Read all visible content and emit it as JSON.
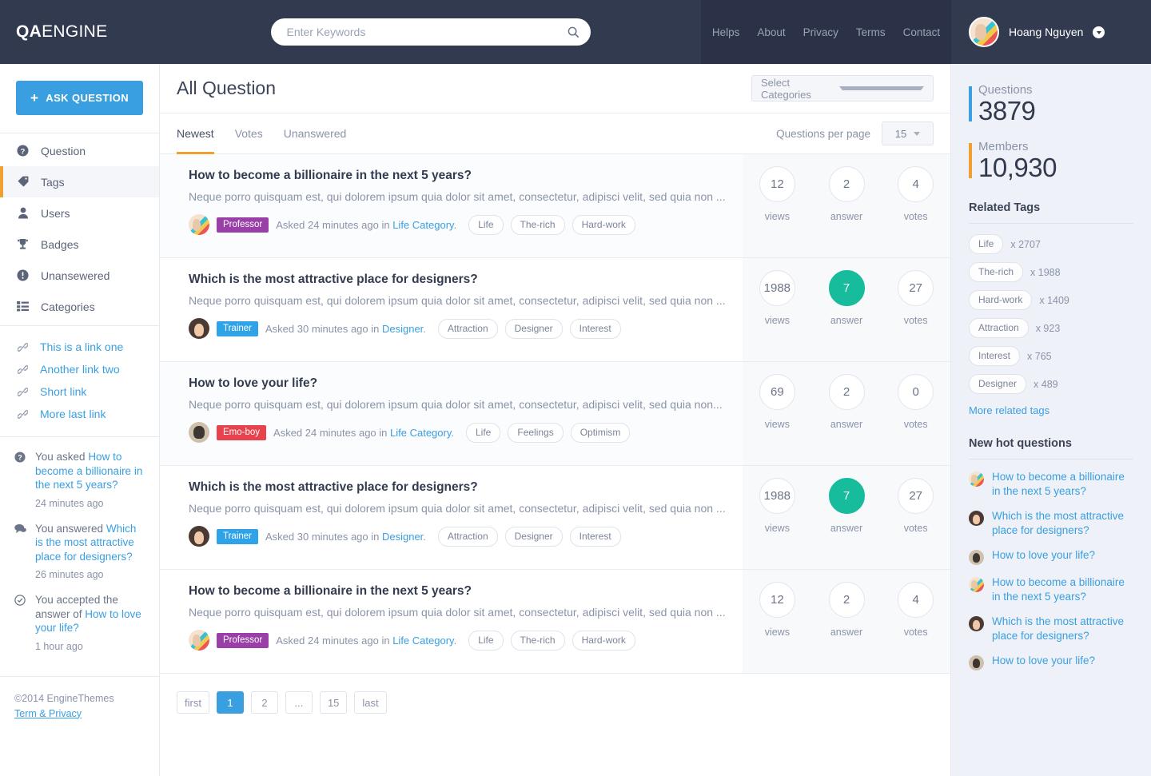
{
  "header": {
    "logo_bold": "QA",
    "logo_rest": "ENGINE",
    "search": {
      "placeholder": "Enter Keywords",
      "value": "",
      "icon": "search-icon"
    },
    "nav": [
      {
        "label": "Helps"
      },
      {
        "label": "About"
      },
      {
        "label": "Privacy"
      },
      {
        "label": "Terms"
      },
      {
        "label": "Contact"
      }
    ],
    "user": {
      "name": "Hoang Nguyen",
      "avatar": "user-avatar",
      "caret": "chevron-down-icon"
    }
  },
  "sidebar": {
    "ask_button": "ASK QUESTION",
    "nav_items": [
      {
        "label": "Question",
        "icon": "question-circle-icon",
        "active": false
      },
      {
        "label": "Tags",
        "icon": "tag-icon",
        "active": true
      },
      {
        "label": "Users",
        "icon": "user-icon",
        "active": false
      },
      {
        "label": "Badges",
        "icon": "trophy-icon",
        "active": false
      },
      {
        "label": "Unansewered",
        "icon": "exclamation-circle-icon",
        "active": false
      },
      {
        "label": "Categories",
        "icon": "list-icon",
        "active": false
      }
    ],
    "links": [
      {
        "label": "This is a link one",
        "icon": "chain-link-icon"
      },
      {
        "label": "Another link two",
        "icon": "chain-link-icon"
      },
      {
        "label": "Short link",
        "icon": "chain-link-icon"
      },
      {
        "label": "More last link",
        "icon": "chain-link-icon"
      }
    ],
    "activity": [
      {
        "icon": "question-circle-icon",
        "prefix": "You asked ",
        "link": "How to become a billionaire in the next 5 years?",
        "time": "24 minutes ago"
      },
      {
        "icon": "comment-icon",
        "prefix": "You answered ",
        "link": "Which is the most attractive place for designers?",
        "time": "26 minutes ago"
      },
      {
        "icon": "check-circle-icon",
        "prefix": "You accepted the answer of ",
        "link": "How to love your life?",
        "time": "1 hour ago"
      }
    ],
    "footer": {
      "copyright": "©2014 EngineThemes",
      "terms_link": "Term & Privacy"
    }
  },
  "main": {
    "page_title": "All Question",
    "category_select": {
      "value": "Select Categories",
      "caret": "chevron-down-icon"
    },
    "tabs": [
      {
        "label": "Newest",
        "active": true
      },
      {
        "label": "Votes",
        "active": false
      },
      {
        "label": "Unanswered",
        "active": false
      }
    ],
    "per_page": {
      "label": "Questions per page",
      "value": "15",
      "caret": "chevron-down-icon"
    },
    "stat_labels": {
      "views": "views",
      "answer": "answer",
      "votes": "votes"
    },
    "questions": [
      {
        "title": "How to become a billionaire in the next 5 years?",
        "excerpt": "Neque porro quisquam est, qui dolorem ipsum quia dolor sit amet, consectetur, adipisci velit, sed quia non ...",
        "badge": {
          "label": "Professor",
          "color": "#9b3fa8",
          "avatar": "av-prof"
        },
        "asked": "Asked 24 minutes ago in ",
        "category": "Life Category",
        "tags": [
          "Life",
          "The-rich",
          "Hard-work"
        ],
        "views": "12",
        "answers": "2",
        "votes": "4",
        "answered": false,
        "shaded": true
      },
      {
        "title": "Which is the most attractive place for designers?",
        "excerpt": "Neque porro quisquam est, qui dolorem ipsum quia dolor sit amet, consectetur, adipisci velit, sed quia non ...",
        "badge": {
          "label": "Trainer",
          "color": "#2fa3e8",
          "avatar": "av-tr"
        },
        "asked": "Asked 30 minutes ago in ",
        "category": "Designer",
        "tags": [
          "Attraction",
          "Designer",
          "Interest"
        ],
        "views": "1988",
        "answers": "7",
        "votes": "27",
        "answered": true,
        "shaded": false
      },
      {
        "title": "How to love your life?",
        "excerpt": "Neque porro quisquam est, qui dolorem ipsum quia dolor sit amet, consectetur, adipisci velit, sed quia non...",
        "badge": {
          "label": "Emo-boy",
          "color": "#e8424c",
          "avatar": "av-emo"
        },
        "asked": "Asked 24 minutes ago in ",
        "category": "Life Category",
        "tags": [
          "Life",
          "Feelings",
          "Optimism"
        ],
        "views": "69",
        "answers": "2",
        "votes": "0",
        "answered": false,
        "shaded": true
      },
      {
        "title": "Which is the most attractive place for designers?",
        "excerpt": "Neque porro quisquam est, qui dolorem ipsum quia dolor sit amet, consectetur, adipisci velit, sed quia non ...",
        "badge": {
          "label": "Trainer",
          "color": "#2fa3e8",
          "avatar": "av-tr"
        },
        "asked": "Asked 30 minutes ago in ",
        "category": "Designer",
        "tags": [
          "Attraction",
          "Designer",
          "Interest"
        ],
        "views": "1988",
        "answers": "7",
        "votes": "27",
        "answered": true,
        "shaded": false
      },
      {
        "title": "How to become a billionaire in the next 5 years?",
        "excerpt": "Neque porro quisquam est, qui dolorem ipsum quia dolor sit amet, consectetur, adipisci velit, sed quia non ...",
        "badge": {
          "label": "Professor",
          "color": "#9b3fa8",
          "avatar": "av-prof"
        },
        "asked": "Asked 24 minutes ago in ",
        "category": "Life Category",
        "tags": [
          "Life",
          "The-rich",
          "Hard-work"
        ],
        "views": "12",
        "answers": "2",
        "votes": "4",
        "answered": false,
        "shaded": false
      }
    ],
    "pagination": [
      {
        "label": "first",
        "active": false
      },
      {
        "label": "1",
        "active": true
      },
      {
        "label": "2",
        "active": false
      },
      {
        "label": "...",
        "active": false
      },
      {
        "label": "15",
        "active": false
      },
      {
        "label": "last",
        "active": false
      }
    ]
  },
  "right": {
    "questions_stat": {
      "label": "Questions",
      "value": "3879",
      "accent": "#3a9fe0"
    },
    "members_stat": {
      "label": "Members",
      "value": "10,930",
      "accent": "#f0a030"
    },
    "related_tags_title": "Related Tags",
    "related_tags": [
      {
        "tag": "Life",
        "count": "x 2707"
      },
      {
        "tag": "The-rich",
        "count": "x 1988"
      },
      {
        "tag": "Hard-work",
        "count": "x 1409"
      },
      {
        "tag": "Attraction",
        "count": "x 923"
      },
      {
        "tag": "Interest",
        "count": "x 765"
      },
      {
        "tag": "Designer",
        "count": "x 489"
      }
    ],
    "more_tags_link": "More related tags",
    "hot_title": "New hot questions",
    "hot_questions": [
      {
        "title": "How to become a billionaire in the next 5 years?",
        "avatar": "av-prof"
      },
      {
        "title": "Which is the most attractive place for designers?",
        "avatar": "av-tr"
      },
      {
        "title": "How to love your life?",
        "avatar": "av-emo"
      },
      {
        "title": "How to become a billionaire in the next 5 years?",
        "avatar": "av-prof"
      },
      {
        "title": "Which is the most attractive place for designers?",
        "avatar": "av-tr"
      },
      {
        "title": "How to love your life?",
        "avatar": "av-emo"
      }
    ]
  }
}
